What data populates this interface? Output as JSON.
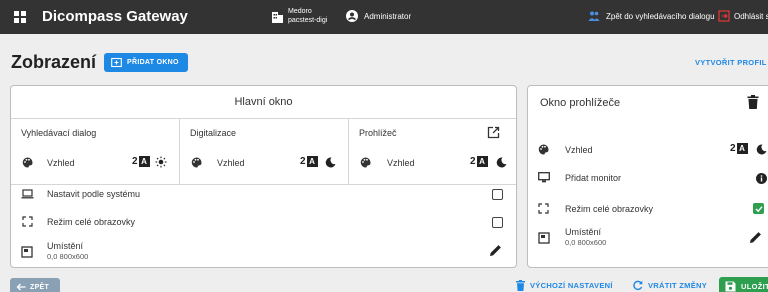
{
  "header": {
    "app_title": "Dicompass Gateway",
    "org_line1": "Medoro",
    "org_line2": "pacstest-digi",
    "user": "Administrator",
    "back_to_search": "Zpět do vyhledávacího dialogu",
    "logout": "Odhlásit se"
  },
  "page": {
    "title": "Zobrazení",
    "add_window": "PŘIDAT OKNO",
    "create_profile": "VYTVOŘIT PROFIL"
  },
  "main_window": {
    "title": "Hlavní okno",
    "columns": [
      {
        "label": "Vyhledávací dialog",
        "appearance_label": "Vzhled",
        "number": "2",
        "badge": "A",
        "theme_icon": "sun-icon"
      },
      {
        "label": "Digitalizace",
        "appearance_label": "Vzhled",
        "number": "2",
        "badge": "A",
        "theme_icon": "moon-icon"
      },
      {
        "label": "Prohlížeč",
        "appearance_label": "Vzhled",
        "number": "2",
        "badge": "A",
        "theme_icon": "moon-icon"
      }
    ],
    "rows": {
      "system": "Nastavit podle systému",
      "fullscreen": "Režim celé obrazovky",
      "location_label": "Umístění",
      "location_value": "0,0 800x600"
    },
    "system_checked": false,
    "fullscreen_checked": false
  },
  "viewer_window": {
    "title": "Okno prohlížeče",
    "appearance_label": "Vzhled",
    "number": "2",
    "badge": "A",
    "theme_icon": "moon-icon",
    "add_monitor": "Přidat monitor",
    "fullscreen": "Režim celé obrazovky",
    "fullscreen_checked": true,
    "location_label": "Umístění",
    "location_value": "0,0 800x600"
  },
  "footer": {
    "back": "ZPĚT",
    "default_settings": "VÝCHOZÍ NASTAVENÍ",
    "revert": "VRÁTIT ZMĚNY",
    "save": "ULOŽIT"
  },
  "colors": {
    "topbar": "#333333",
    "accent": "#1e88e5",
    "save": "#2e9e4f",
    "back": "#8aa0b4",
    "logout_icon": "#e53935"
  }
}
